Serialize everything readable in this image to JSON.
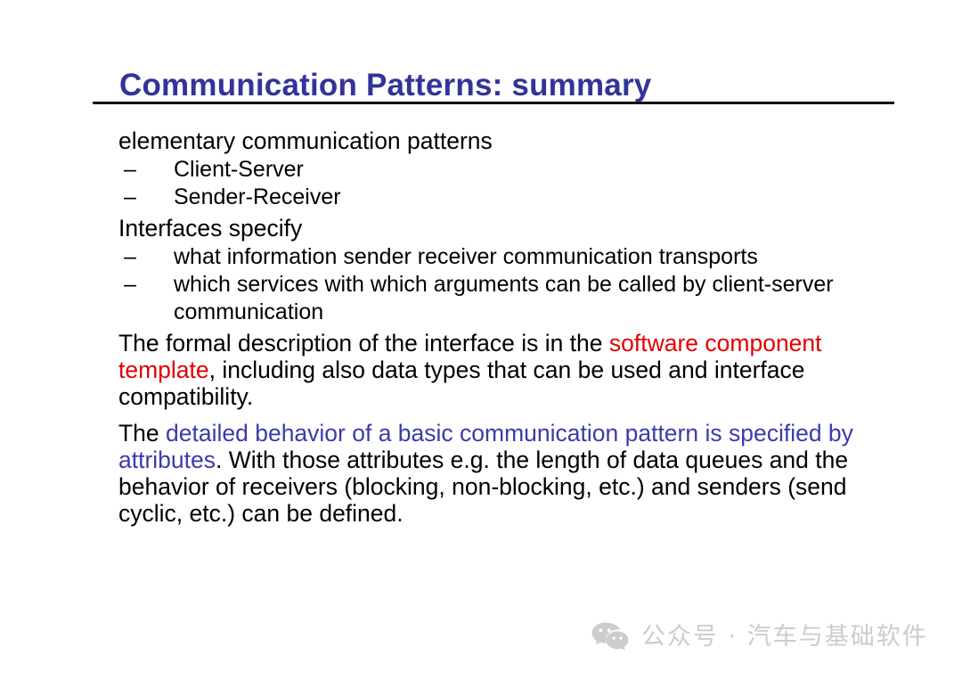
{
  "slide": {
    "title": "Communication Patterns: summary",
    "title_color": "#33339a",
    "rule_color": "#111111",
    "background": "#ffffff"
  },
  "content": {
    "heading_1": "elementary communication patterns",
    "bullets_1": [
      {
        "dash": "–",
        "text": "Client-Server"
      },
      {
        "dash": "–",
        "text": "Sender-Receiver"
      }
    ],
    "heading_2": "Interfaces specify",
    "bullets_2": [
      {
        "dash": "–",
        "text": "what information sender receiver communication transports"
      },
      {
        "dash": "–",
        "text": "which services with which arguments can be called by client-server communication"
      }
    ],
    "paragraph_1": {
      "part_1": "The formal description of the interface is in the ",
      "highlight": "software component template",
      "highlight_color": "#e00000",
      "part_2": ", including also data types that can be used and interface compatibility."
    },
    "paragraph_2": {
      "part_1": "The ",
      "highlight": "detailed behavior of a basic communication pattern is specified by attributes",
      "highlight_color": "#3b3bab",
      "part_2": ". With those attributes e.g. the length of data queues and the behavior of receivers (blocking, non-blocking, etc.) and senders (send cyclic, etc.) can be defined."
    }
  },
  "watermark": {
    "icon": "wechat-icon",
    "text": "公众号 · 汽车与基础软件",
    "color": "#cccccc"
  }
}
